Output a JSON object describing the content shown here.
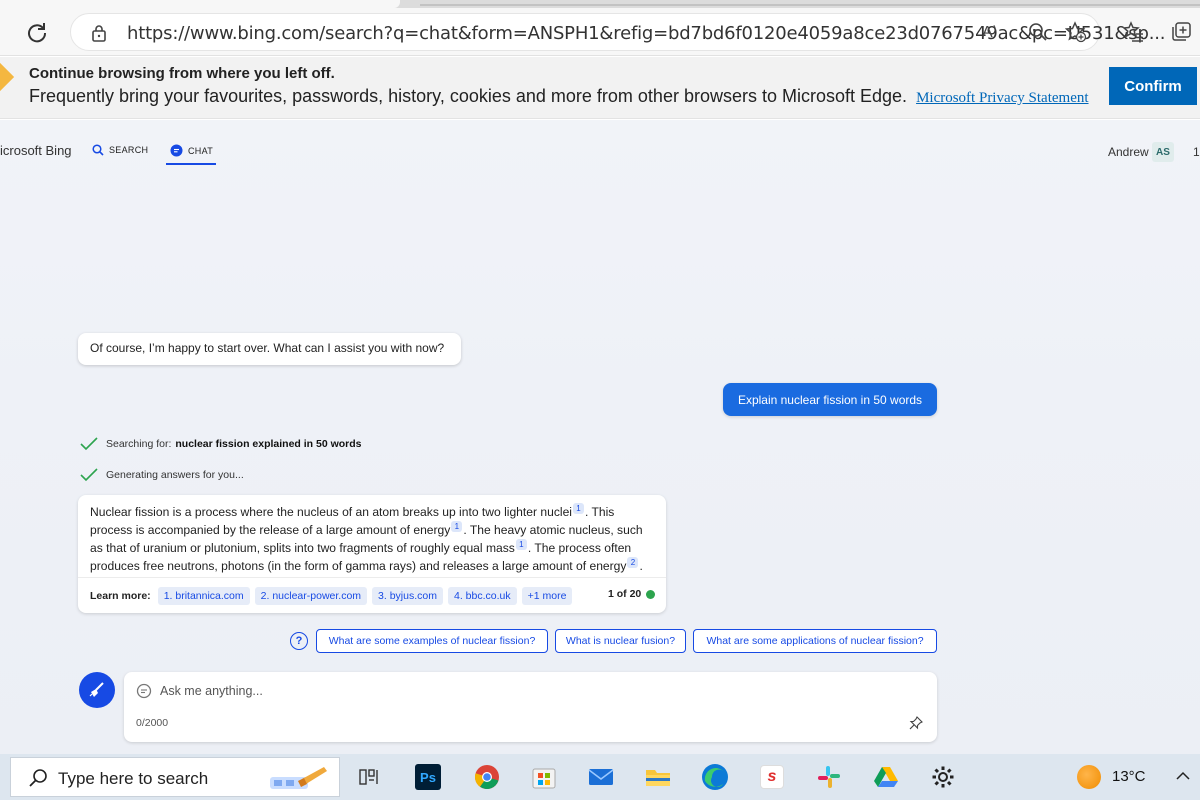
{
  "browser": {
    "url": "https://www.bing.com/search?q=chat&form=ANSPH1&refig=bd7bd6f0120e4059a8ce23d0767549ac&pc=U531&sp...",
    "read_aloud_glyph": "A⁾",
    "icons": [
      "refresh-icon",
      "lock-icon",
      "read-aloud-icon",
      "zoom-icon",
      "add-favorite-icon",
      "favorites-icon",
      "collections-icon"
    ]
  },
  "infobar": {
    "title": "Continue browsing from where you left off.",
    "text": "Frequently bring your favourites, passwords, history, cookies and more from other browsers to Microsoft Edge.",
    "link": "Microsoft Privacy Statement",
    "confirm_label": "Confirm"
  },
  "bing_header": {
    "logo_text": "icrosoft Bing",
    "nav": {
      "search": "SEARCH",
      "chat": "CHAT"
    },
    "user_name": "Andrew",
    "user_initials": "AS",
    "reward_count": "1"
  },
  "chat": {
    "bot_greeting": "Of course, I’m happy to start over. What can I assist you with now?",
    "user_message": "Explain nuclear fission in 50 words",
    "status": {
      "searching_label": "Searching for:",
      "searching_query": "nuclear fission explained in 50 words",
      "generating": "Generating answers for you..."
    },
    "answer": {
      "s1": "Nuclear fission is a process where the nucleus of an atom breaks up into two lighter nuclei",
      "s2": ". This process is accompanied by the release of a large amount of energy",
      "s3": ". The heavy atomic nucleus, such as that of uranium or plutonium, splits into two fragments of roughly equal mass",
      "s4": ". The process often produces free neutrons, photons (in the form of gamma rays) and releases a large amount of energy",
      "s5": ".",
      "cite1": "1",
      "cite2": "2"
    },
    "learn_more": {
      "label": "Learn more:",
      "sources": [
        "1. britannica.com",
        "2. nuclear-power.com",
        "3. byjus.com",
        "4. bbc.co.uk",
        "+1 more"
      ],
      "counter": "1 of 20"
    },
    "suggestions": [
      "What are some examples of nuclear fission?",
      "What is nuclear fusion?",
      "What are some applications of nuclear fission?"
    ],
    "help_glyph": "?",
    "input": {
      "placeholder": "Ask me anything...",
      "char_count": "0/2000"
    }
  },
  "taskbar": {
    "search_placeholder": "Type here to search",
    "apps": [
      "task-view-icon",
      "photoshop-icon",
      "chrome-icon",
      "microsoft-store-icon",
      "mail-icon",
      "file-explorer-icon",
      "edge-icon",
      "scribd-icon",
      "slack-icon",
      "google-drive-icon",
      "settings-icon"
    ],
    "photoshop_label": "Ps",
    "temperature": "13°C"
  },
  "colors": {
    "bing_blue": "#174ae4",
    "user_bubble": "#1a6be0",
    "confirm_blue": "#0067b8",
    "status_green": "#2da44e"
  }
}
